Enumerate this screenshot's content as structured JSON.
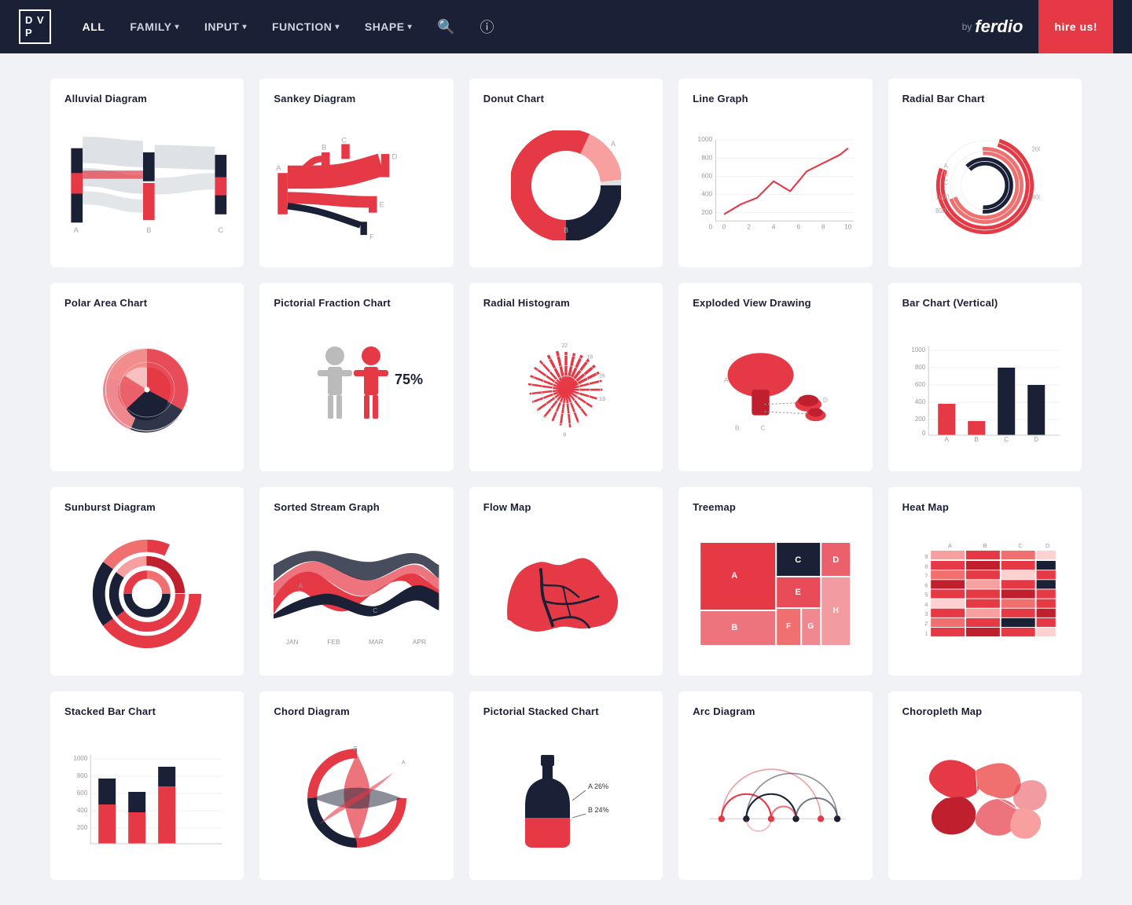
{
  "nav": {
    "logo_line1": "D V",
    "logo_line2": "P",
    "links": [
      {
        "label": "ALL",
        "has_chevron": false
      },
      {
        "label": "FAMILY",
        "has_chevron": true
      },
      {
        "label": "INPUT",
        "has_chevron": true
      },
      {
        "label": "FUNCTION",
        "has_chevron": true
      },
      {
        "label": "SHAPE",
        "has_chevron": true
      }
    ],
    "by_label": "by",
    "brand": "ferdio",
    "hire_label": "hire us!"
  },
  "charts": [
    {
      "id": "alluvial",
      "title": "Alluvial Diagram"
    },
    {
      "id": "sankey",
      "title": "Sankey Diagram"
    },
    {
      "id": "donut",
      "title": "Donut Chart"
    },
    {
      "id": "linegraph",
      "title": "Line Graph"
    },
    {
      "id": "radialbar",
      "title": "Radial Bar Chart"
    },
    {
      "id": "polararea",
      "title": "Polar Area Chart"
    },
    {
      "id": "pictorialfraction",
      "title": "Pictorial Fraction Chart"
    },
    {
      "id": "radialhistogram",
      "title": "Radial Histogram"
    },
    {
      "id": "explodedview",
      "title": "Exploded View Drawing"
    },
    {
      "id": "barchart",
      "title": "Bar Chart (Vertical)"
    },
    {
      "id": "sunburst",
      "title": "Sunburst Diagram"
    },
    {
      "id": "streamgraph",
      "title": "Sorted Stream Graph"
    },
    {
      "id": "flowmap",
      "title": "Flow Map"
    },
    {
      "id": "treemap",
      "title": "Treemap"
    },
    {
      "id": "heatmap",
      "title": "Heat Map"
    },
    {
      "id": "stackedbar",
      "title": "Stacked Bar Chart"
    },
    {
      "id": "chord",
      "title": "Chord Diagram"
    },
    {
      "id": "pictorialstacked",
      "title": "Pictorial Stacked Chart"
    },
    {
      "id": "arcdiagram",
      "title": "Arc Diagram"
    },
    {
      "id": "choropleth",
      "title": "Choropleth Map"
    }
  ]
}
